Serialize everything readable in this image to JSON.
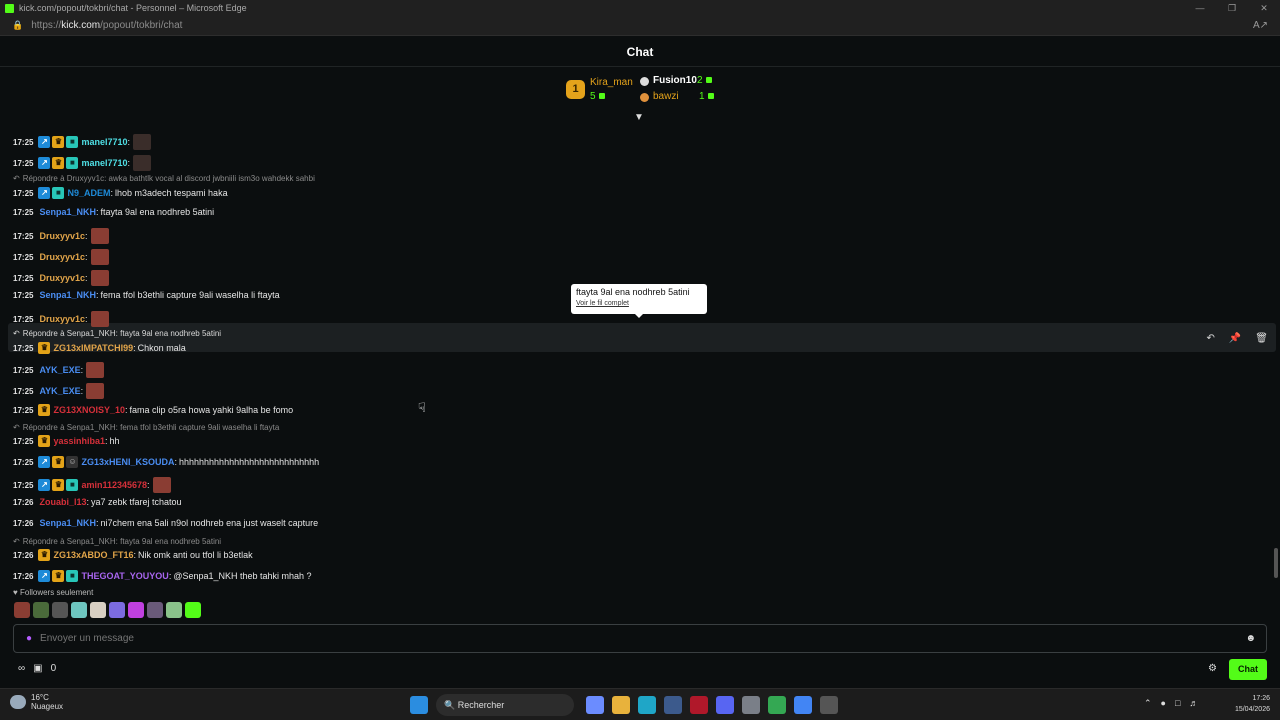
{
  "window": {
    "title": "kick.com/popout/tokbri/chat - Personnel – Microsoft Edge",
    "controls": [
      "—",
      "❐",
      "✕"
    ]
  },
  "address": {
    "prefix": "https://",
    "host": "kick.com",
    "path": "/popout/tokbri/chat"
  },
  "chat": {
    "title": "Chat"
  },
  "leaderboard": {
    "first": {
      "rank": "1",
      "name": "Kira_man",
      "count": "5"
    },
    "second": {
      "name": "Fusion10",
      "count": "2"
    },
    "third": {
      "name": "bawzi",
      "count": "1"
    }
  },
  "messages": [
    {
      "time": "17:25",
      "user": "manel7710",
      "text": "",
      "color": "#4fe0e6"
    },
    {
      "time": "17:25",
      "user": "manel7710",
      "text": "",
      "color": "#4fe0e6"
    },
    {
      "reply": "Répondre à Druxyyv1c: awka bathtlk vocal al discord jwbniili ism3o wahdekk sahbi"
    },
    {
      "time": "17:25",
      "user": "N9_ADEM",
      "text": "lhob m3adech tespami haka",
      "color": "#1e8bd8"
    },
    {
      "time": "17:25",
      "user": "Senpa1_NKH",
      "text": "ftayta 9al ena nodhreb 5atini",
      "color": "#4a8df2"
    },
    {
      "time": "17:25",
      "user": "Druxyyv1c",
      "text": "",
      "color": "#e2a54a"
    },
    {
      "time": "17:25",
      "user": "Druxyyv1c",
      "text": "",
      "color": "#e2a54a"
    },
    {
      "time": "17:25",
      "user": "Druxyyv1c",
      "text": "",
      "color": "#e2a54a"
    },
    {
      "time": "17:25",
      "user": "Senpa1_NKH",
      "text": "fema tfol b3ethli capture 9ali waselha li ftayta",
      "color": "#4a8df2"
    },
    {
      "time": "17:25",
      "user": "Druxyyv1c",
      "text": "",
      "color": "#e2a54a"
    },
    {
      "reply": "Répondre à Senpa1_NKH: ftayta 9al ena nodhreb 5atini"
    },
    {
      "time": "17:25",
      "user": "ZG13xIMPATCHI99",
      "text": "Chkon mala",
      "color": "#e2a54a"
    },
    {
      "time": "17:25",
      "user": "AYK_EXE",
      "text": "",
      "color": "#4a8df2"
    },
    {
      "time": "17:25",
      "user": "AYK_EXE",
      "text": "",
      "color": "#4a8df2"
    },
    {
      "time": "17:25",
      "user": "ZG13XNOISY_10",
      "text": "fama clip o5ra howa yahki 9alha be fomo",
      "color": "#d6303a"
    },
    {
      "reply": "Répondre à Senpa1_NKH: fema tfol b3ethli capture 9ali waselha li ftayta"
    },
    {
      "time": "17:25",
      "user": "yassinhiba1",
      "text": "hh",
      "color": "#d6303a"
    },
    {
      "time": "17:25",
      "user": "ZG13xHENI_KSOUDA",
      "text": "hhhhhhhhhhhhhhhhhhhhhhhhhhhh",
      "color": "#4a8df2"
    },
    {
      "time": "17:25",
      "user": "amin112345678",
      "text": "",
      "color": "#d6303a"
    },
    {
      "time": "17:26",
      "user": "Zouabi_l13",
      "text": "ya7 zebk tfarej tchatou",
      "color": "#d6303a"
    },
    {
      "time": "17:26",
      "user": "Senpa1_NKH",
      "text": "ni7chem ena 5ali n9ol nodhreb ena just waselt capture",
      "color": "#4a8df2"
    },
    {
      "reply": "Répondre à Senpa1_NKH: ftayta 9al ena nodhreb 5atini"
    },
    {
      "time": "17:26",
      "user": "ZG13xABDO_FT16",
      "text": "Nik omk anti ou tfol li b3etlak",
      "color": "#e2a54a"
    },
    {
      "time": "17:26",
      "user": "THEGOAT_YOUYOU",
      "text": "@Senpa1_NKH theb tahki mhah ?",
      "color": "#a865ef"
    }
  ],
  "tooltip": {
    "text": "ftayta 9al ena nodhreb 5atini",
    "link": "Voir le fil complet"
  },
  "followers_label": "Followers seulement",
  "input": {
    "placeholder": "Envoyer un message"
  },
  "bottom": {
    "points": "0",
    "chat_button": "Chat"
  },
  "taskbar": {
    "temp": "16°C",
    "weather": "Nuageux",
    "search": "Rechercher",
    "time": "17:26",
    "date": "15/04/2026"
  }
}
